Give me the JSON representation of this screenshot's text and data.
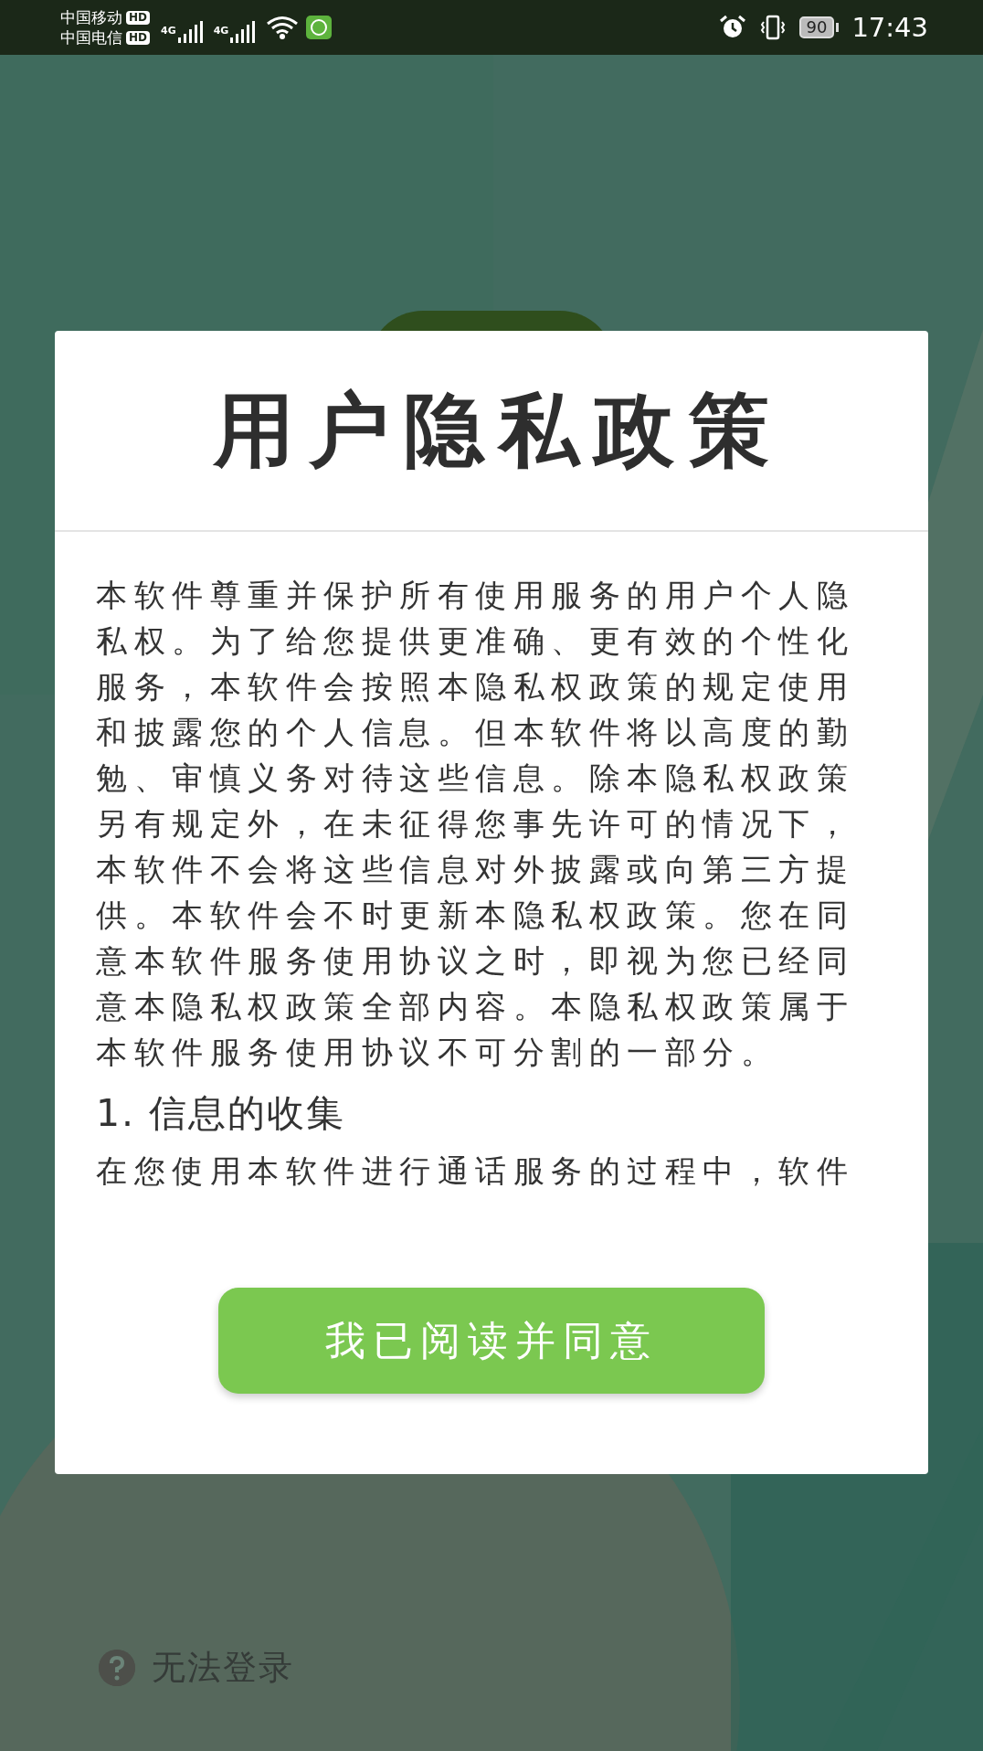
{
  "status_bar": {
    "carriers": [
      {
        "name": "中国移动",
        "badge": "HD"
      },
      {
        "name": "中国电信",
        "badge": "HD"
      }
    ],
    "signals": [
      {
        "network": "4G"
      },
      {
        "network": "4G"
      }
    ],
    "battery": "90",
    "time": "17:43"
  },
  "dialog": {
    "title": "用户隐私政策",
    "blocks": [
      {
        "kind": "text",
        "text": "本软件尊重并保护所有使用服务的用户个人隐私权。为了给您提供更准确、更有效的个性化服务，本软件会按照本隐私权政策的规定使用和披露您的个人信息。但本软件将以高度的勤勉、审慎义务对待这些信息。除本隐私权政策另有规定外，在未征得您事先许可的情况下，本软件不会将这些信息对外披露或向第三方提供。本软件会不时更新本隐私权政策。您在同意本软件服务使用协议之时，即视为您已经同意本隐私权政策全部内容。本隐私权政策属于本软件服务使用协议不可分割的一部分。"
      },
      {
        "kind": "heading",
        "text": "1. 信息的收集"
      },
      {
        "kind": "text",
        "text": "在您使用本软件进行通话服务的过程中，软件"
      }
    ],
    "button": "我已阅读并同意"
  },
  "help_link": "无法登录"
}
